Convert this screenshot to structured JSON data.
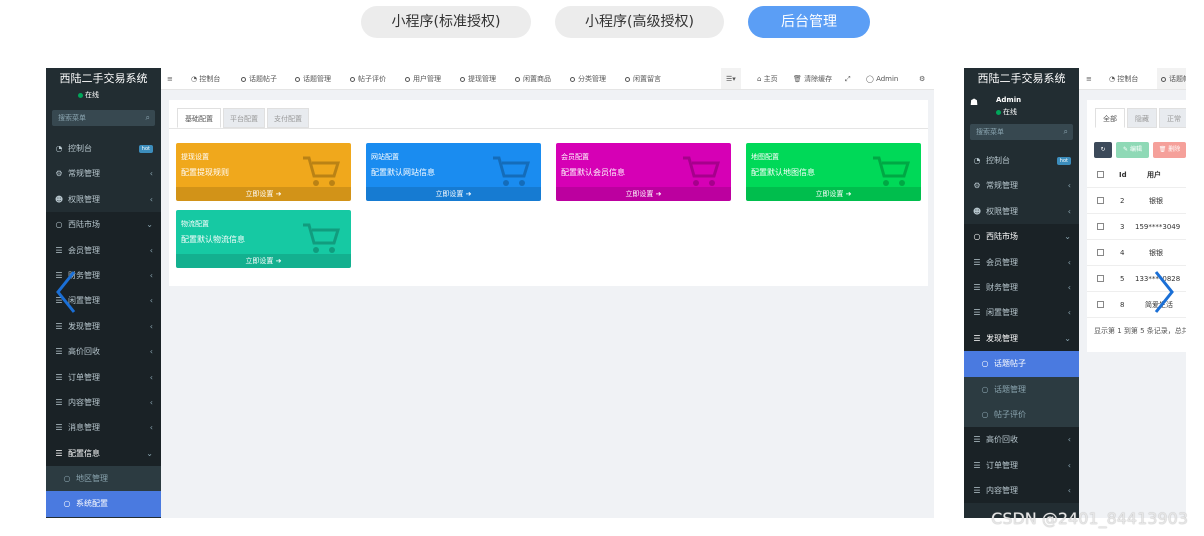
{
  "tabs": [
    {
      "label": "小程序(标准授权)",
      "active": false
    },
    {
      "label": "小程序(高级授权)",
      "active": false
    },
    {
      "label": "后台管理",
      "active": true
    }
  ],
  "left_shot": {
    "brand": "西陆二手交易系统",
    "user_status": "在线",
    "search_placeholder": "搜索菜单",
    "menu": [
      {
        "label": "控制台",
        "badge": "hot"
      },
      {
        "label": "常规管理"
      },
      {
        "label": "权限管理"
      },
      {
        "label": "西陆市场"
      },
      {
        "label": "会员管理"
      },
      {
        "label": "财务管理"
      },
      {
        "label": "闲置管理"
      },
      {
        "label": "发现管理"
      },
      {
        "label": "高价回收"
      },
      {
        "label": "订单管理"
      },
      {
        "label": "内容管理"
      },
      {
        "label": "消息管理"
      },
      {
        "label": "配置信息"
      },
      {
        "label": "地区管理"
      },
      {
        "label": "系统配置"
      }
    ],
    "topnav": [
      "控制台",
      "话题帖子",
      "话题管理",
      "帖子评价",
      "用户管理",
      "提现管理",
      "闲置商品",
      "分类管理",
      "闲置留言"
    ],
    "top_right": {
      "home": "主页",
      "clear": "清除缓存",
      "admin": "Admin"
    },
    "sub_tabs": [
      "基础配置",
      "平台配置",
      "支付配置"
    ],
    "cards": [
      {
        "t1": "提现设置",
        "t2": "配置提现规则",
        "foot": "立即设置",
        "color": "#f0a81c"
      },
      {
        "t1": "网站配置",
        "t2": "配置默认网站信息",
        "foot": "立即设置",
        "color": "#1a8cf0"
      },
      {
        "t1": "会员配置",
        "t2": "配置默认会员信息",
        "foot": "立即设置",
        "color": "#d600b5"
      },
      {
        "t1": "地图配置",
        "t2": "配置默认地图信息",
        "foot": "立即设置",
        "color": "#00d958"
      },
      {
        "t1": "物流配置",
        "t2": "配置默认物流信息",
        "foot": "立即设置",
        "color": "#16c9a3"
      }
    ]
  },
  "right_shot": {
    "brand": "西陆二手交易系统",
    "admin": "Admin",
    "status": "在线",
    "search_placeholder": "搜索菜单",
    "menu": [
      {
        "label": "控制台",
        "badge": "hot"
      },
      {
        "label": "常规管理"
      },
      {
        "label": "权限管理"
      },
      {
        "label": "西陆市场"
      },
      {
        "label": "会员管理"
      },
      {
        "label": "财务管理"
      },
      {
        "label": "闲置管理"
      },
      {
        "label": "发现管理"
      },
      {
        "label": "话题帖子"
      },
      {
        "label": "话题管理"
      },
      {
        "label": "帖子评价"
      },
      {
        "label": "高价回收"
      },
      {
        "label": "订单管理"
      },
      {
        "label": "内容管理"
      }
    ],
    "topnav": [
      "控制台",
      "话题帖"
    ],
    "filter_tabs": [
      "全部",
      "隐藏",
      "正常"
    ],
    "buttons": {
      "edit": "编辑",
      "delete": "删除"
    },
    "columns": [
      "Id",
      "用户"
    ],
    "rows": [
      {
        "id": "2",
        "user": "银银"
      },
      {
        "id": "3",
        "user": "159****3049"
      },
      {
        "id": "4",
        "user": "银银"
      },
      {
        "id": "5",
        "user": "133****0828"
      },
      {
        "id": "8",
        "user": "简爱生活"
      }
    ],
    "footer": "显示第 1 到第 5 条记录，总共"
  },
  "watermark": "CSDN @2401_84413903"
}
